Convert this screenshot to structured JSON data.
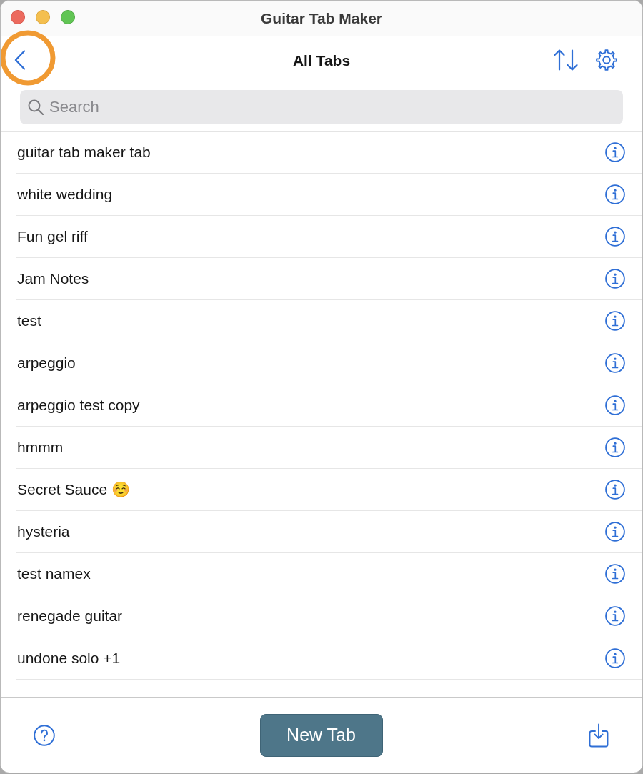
{
  "window": {
    "title": "Guitar Tab Maker"
  },
  "nav_bar": {
    "back_button": {
      "highlighted": true
    },
    "title": "All Tabs"
  },
  "search": {
    "placeholder": "Search"
  },
  "tabs": [
    {
      "name": "guitar tab maker tab"
    },
    {
      "name": "white wedding"
    },
    {
      "name": "Fun gel riff"
    },
    {
      "name": "Jam Notes"
    },
    {
      "name": "test"
    },
    {
      "name": "arpeggio"
    },
    {
      "name": "arpeggio test copy"
    },
    {
      "name": "hmmm"
    },
    {
      "name": "Secret Sauce ☺️"
    },
    {
      "name": "hysteria"
    },
    {
      "name": "test namex"
    },
    {
      "name": "renegade guitar"
    },
    {
      "name": "undone solo +1"
    }
  ],
  "footer": {
    "new_button": "New Tab"
  }
}
